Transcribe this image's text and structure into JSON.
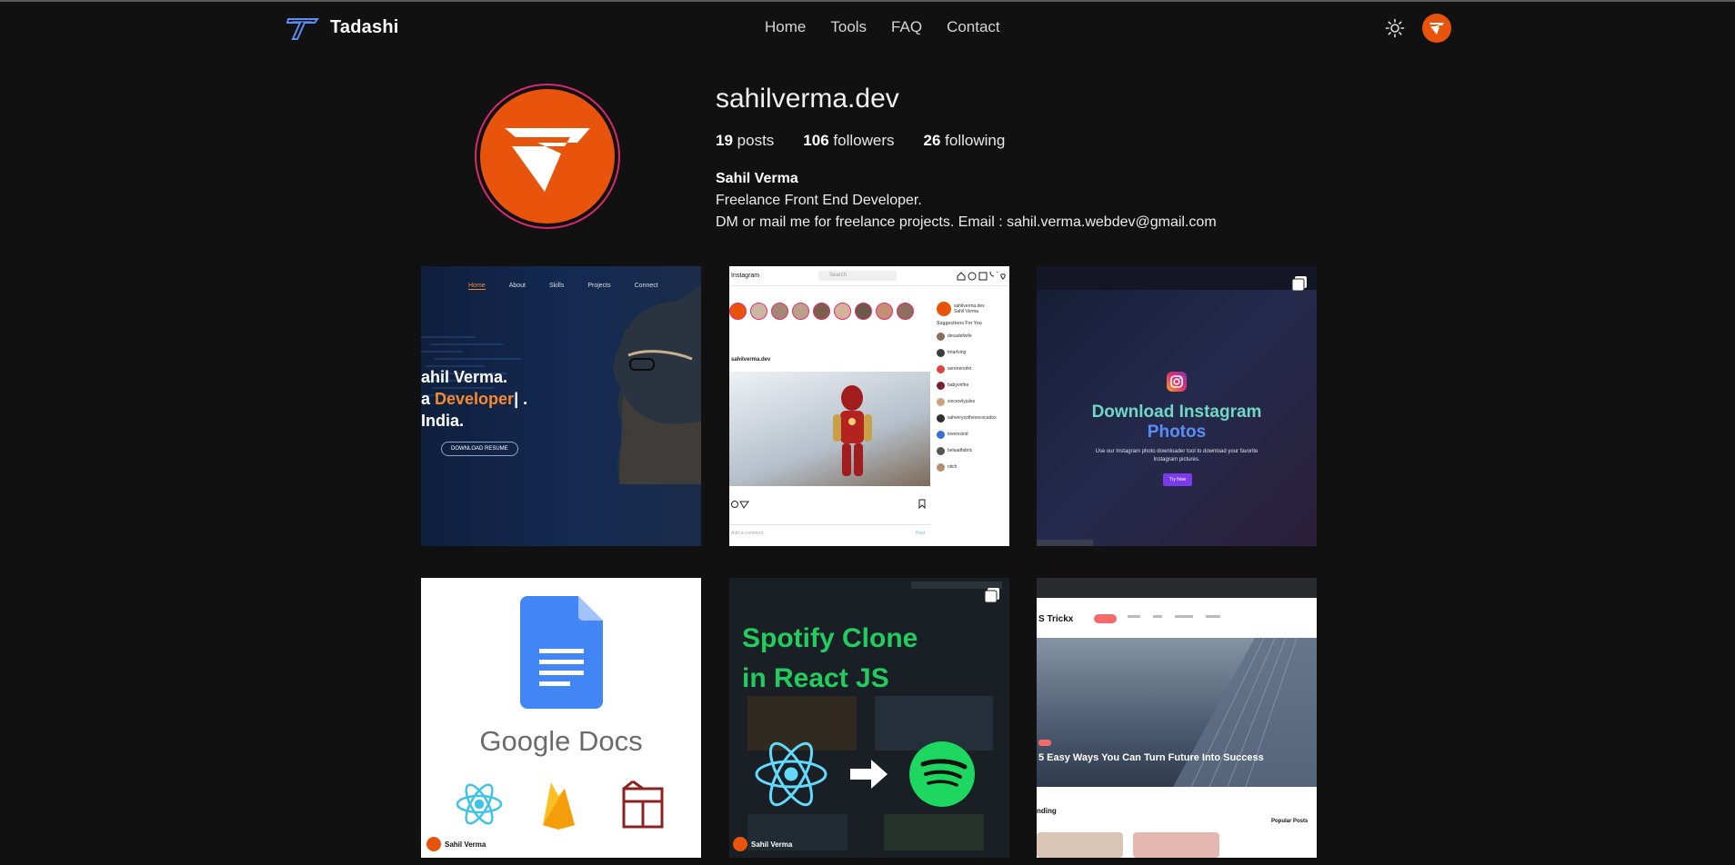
{
  "nav": {
    "brand": "Tadashi",
    "links": [
      "Home",
      "Tools",
      "FAQ",
      "Contact"
    ]
  },
  "profile": {
    "username": "sahilverma.dev",
    "posts_count": "19",
    "posts_label": "posts",
    "followers_count": "106",
    "followers_label": "followers",
    "following_count": "26",
    "following_label": "following",
    "full_name": "Sahil Verma",
    "bio_line1": "Freelance Front End Developer.",
    "bio_line2": "DM or mail me for freelance projects. Email : sahil.verma.webdev@gmail.com"
  },
  "posts": {
    "p1": {
      "nav": [
        "Home",
        "About",
        "Skills",
        "Projects",
        "Connect"
      ],
      "line1": "ahil Verma.",
      "line2_prefix": "a ",
      "line2_highlight": "Developer",
      "line2_suffix": "| .",
      "line3": "India.",
      "button": "DOWNLOAD RESUME"
    },
    "p2": {
      "app": "Instagram",
      "search": "Search",
      "post_user": "sahilverma.dev",
      "me_handle": "sahilverma.dev",
      "me_name": "Sahil Verma",
      "suggestions_title": "Suggestions For You",
      "suggestions": [
        "decadefwife",
        "tmarlving",
        "serenenofxt",
        "babyonfire",
        "sincerelyjules",
        "sahverysothexecocados",
        "lovemsind",
        "belaadfabric",
        "nitch"
      ],
      "comment_placeholder": "Add a comment...",
      "post_action": "Post"
    },
    "p3": {
      "title_line1": "Download Instagram",
      "title_line2": "Photos",
      "subtitle": "Use our Instagram photo downloader tool to download your favorite Instagram pictures.",
      "button": "Try Now"
    },
    "p4": {
      "title": "Google Docs",
      "signature_name": "Sahil Verma"
    },
    "p5": {
      "title_line1": "Spotify Clone",
      "title_line2": "in React JS",
      "signature_name": "Sahil Verma"
    },
    "p6": {
      "logo": "S Trickx",
      "hero_title": "5 Easy Ways You Can Turn Future Into Success",
      "trending": "nding",
      "popular": "Popular Posts"
    }
  },
  "colors": {
    "background": "#111112",
    "accent_orange": "#e9540c",
    "ring_pink": "#d52b6c"
  }
}
